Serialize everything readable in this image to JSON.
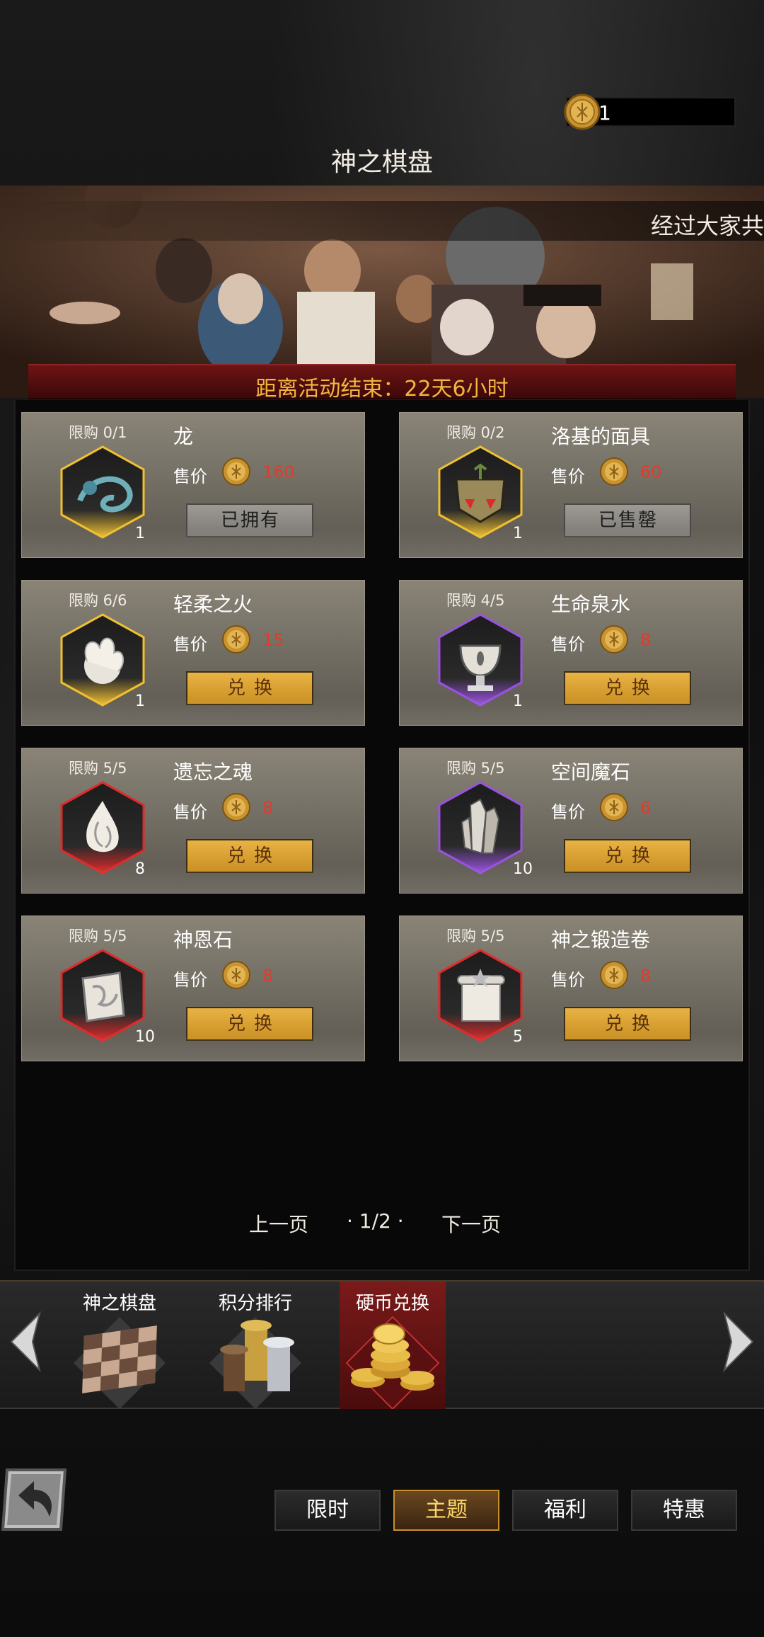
{
  "currency": {
    "amount": "1",
    "icon": "gold-coin-icon"
  },
  "title": "神之棋盘",
  "banner": {
    "ticker": "经过大家共",
    "countdown": "距离活动结束：22天6小时"
  },
  "items": [
    {
      "limit": "限购 0/1",
      "name": "龙",
      "price_label": "售价",
      "price": "160",
      "button": "已拥有",
      "button_state": "disabled",
      "qty": "1",
      "icon": "dragon-icon",
      "rarity": "gold"
    },
    {
      "limit": "限购 0/2",
      "name": "洛基的面具",
      "price_label": "售价",
      "price": "60",
      "button": "已售罄",
      "button_state": "disabled",
      "qty": "1",
      "icon": "mask-icon",
      "rarity": "gold"
    },
    {
      "limit": "限购 6/6",
      "name": "轻柔之火",
      "price_label": "售价",
      "price": "15",
      "button": "兑换",
      "button_state": "enabled",
      "qty": "1",
      "icon": "fire-orb-icon",
      "rarity": "gold"
    },
    {
      "limit": "限购 4/5",
      "name": "生命泉水",
      "price_label": "售价",
      "price": "8",
      "button": "兑换",
      "button_state": "enabled",
      "qty": "1",
      "icon": "chalice-icon",
      "rarity": "purple"
    },
    {
      "limit": "限购 5/5",
      "name": "遗忘之魂",
      "price_label": "售价",
      "price": "8",
      "button": "兑换",
      "button_state": "enabled",
      "qty": "8",
      "icon": "soul-flame-icon",
      "rarity": "red"
    },
    {
      "limit": "限购 5/5",
      "name": "空间魔石",
      "price_label": "售价",
      "price": "6",
      "button": "兑换",
      "button_state": "enabled",
      "qty": "10",
      "icon": "crystal-icon",
      "rarity": "purple"
    },
    {
      "limit": "限购 5/5",
      "name": "神恩石",
      "price_label": "售价",
      "price": "8",
      "button": "兑换",
      "button_state": "enabled",
      "qty": "10",
      "icon": "rune-stone-icon",
      "rarity": "red"
    },
    {
      "limit": "限购 5/5",
      "name": "神之锻造卷",
      "price_label": "售价",
      "price": "8",
      "button": "兑换",
      "button_state": "enabled",
      "qty": "5",
      "icon": "scroll-icon",
      "rarity": "red"
    }
  ],
  "pager": {
    "prev": "上一页",
    "page": "· 1/2 ·",
    "next": "下一页"
  },
  "categories": [
    {
      "label": "神之棋盘",
      "icon": "chessboard-icon",
      "active": false
    },
    {
      "label": "积分排行",
      "icon": "trophy-pillars-icon",
      "active": false
    },
    {
      "label": "硬币兑换",
      "icon": "coin-stack-icon",
      "active": true
    }
  ],
  "tabs": [
    {
      "label": "限时",
      "active": false
    },
    {
      "label": "主题",
      "active": true
    },
    {
      "label": "福利",
      "active": false
    },
    {
      "label": "特惠",
      "active": false
    }
  ],
  "colors": {
    "price_red": "#e03c2c",
    "gold_button": "#d89c2c",
    "active_tab_text": "#ffd76a",
    "countdown_text": "#f0b640"
  }
}
